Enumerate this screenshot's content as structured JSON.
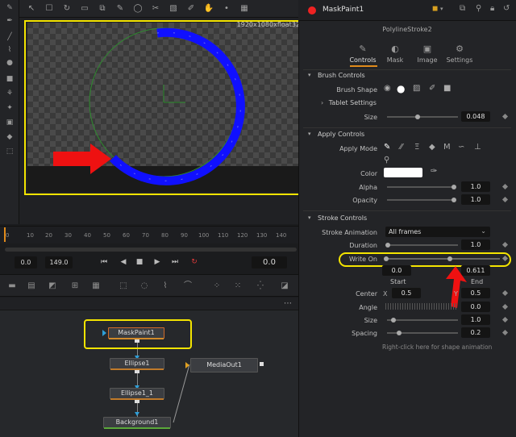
{
  "viewer": {
    "resolution": "1920x1080xfloat32"
  },
  "timeline": {
    "ticks": [
      "0",
      "10",
      "20",
      "30",
      "40",
      "50",
      "60",
      "70",
      "80",
      "90",
      "100",
      "110",
      "120",
      "130",
      "140"
    ],
    "start": "0.0",
    "end": "149.0",
    "current": "0.0"
  },
  "nodes": {
    "maskpaint": "MaskPaint1",
    "ellipse1": "Ellipse1",
    "ellipse1_1": "Ellipse1_1",
    "background": "Background1",
    "mediaout": "MediaOut1"
  },
  "inspector": {
    "node_name": "MaskPaint1",
    "subtitle": "PolylineStroke2",
    "tabs": [
      "Controls",
      "Mask",
      "Image",
      "Settings"
    ],
    "brush_controls": {
      "title": "Brush Controls",
      "brush_shape_label": "Brush Shape",
      "tablet_settings": "Tablet Settings",
      "size_label": "Size",
      "size_value": "0.048",
      "size_level": 0.15
    },
    "apply_controls": {
      "title": "Apply Controls",
      "apply_mode_label": "Apply Mode",
      "color_label": "Color",
      "color_value": "#ffffff",
      "alpha_label": "Alpha",
      "alpha_value": "1.0",
      "opacity_label": "Opacity",
      "opacity_value": "1.0"
    },
    "stroke_controls": {
      "title": "Stroke Controls",
      "stroke_animation_label": "Stroke Animation",
      "stroke_animation_value": "All frames",
      "duration_label": "Duration",
      "duration_value": "1.0",
      "write_on_label": "Write On",
      "write_on_start": "0.0",
      "write_on_end": "0.611",
      "start_label": "Start",
      "end_label": "End",
      "center_label": "Center",
      "center_x_label": "X",
      "center_x": "0.5",
      "center_y_label": "Y",
      "center_y": "0.5",
      "angle_label": "Angle",
      "angle_value": "0.0",
      "size_label": "Size",
      "size_value": "1.0",
      "spacing_label": "Spacing",
      "spacing_value": "0.2",
      "hint": "Right-click here for shape animation"
    }
  },
  "colors": {
    "highlight": "#f4e400",
    "stroke": "#1010ff",
    "arrow": "#ee1111"
  }
}
